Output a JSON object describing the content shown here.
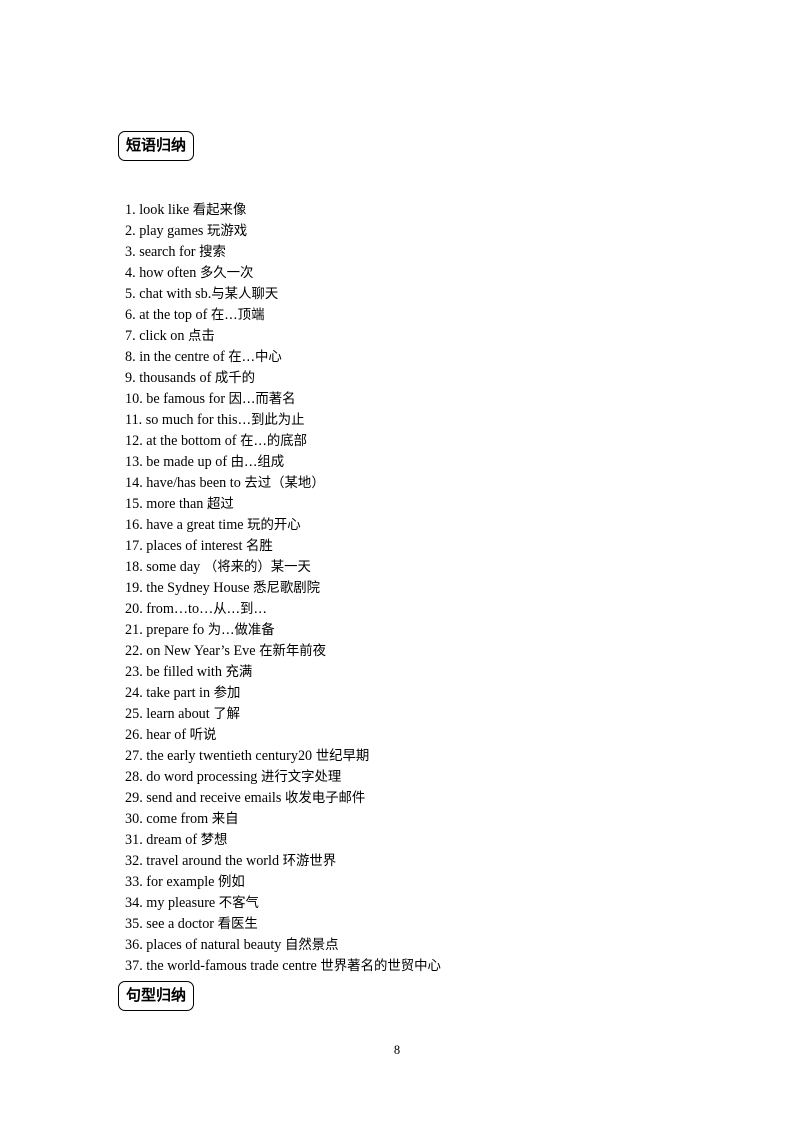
{
  "document": {
    "page_number": "8"
  },
  "sections": {
    "phrases_heading": "短语归纳",
    "sentences_heading": "句型归纳"
  },
  "phrases": [
    {
      "num": "1.",
      "english": "look like ",
      "chinese": "看起来像"
    },
    {
      "num": "2.",
      "english": "play games ",
      "chinese": "玩游戏"
    },
    {
      "num": "3.",
      "english": "search for ",
      "chinese": "搜索"
    },
    {
      "num": "4.",
      "english": "how often ",
      "chinese": "多久一次"
    },
    {
      "num": "5.",
      "english": "chat with sb.",
      "chinese": "与某人聊天"
    },
    {
      "num": "6.",
      "english": "at the top of ",
      "chinese": "在…顶端"
    },
    {
      "num": "7.",
      "english": "click on ",
      "chinese": "点击"
    },
    {
      "num": "8.",
      "english": "in the centre of  ",
      "chinese": "在…中心"
    },
    {
      "num": "9.",
      "english": "thousands of ",
      "chinese": "成千的"
    },
    {
      "num": "10.",
      "english": "be famous for ",
      "chinese": "因…而著名"
    },
    {
      "num": "11.",
      "english": "so much for this",
      "chinese": "…到此为止"
    },
    {
      "num": "12.",
      "english": "at the bottom of ",
      "chinese": "在…的底部"
    },
    {
      "num": "13.",
      "english": "be made up of ",
      "chinese": "由…组成"
    },
    {
      "num": "14.",
      "english": "have/has been to ",
      "chinese": "去过（某地）"
    },
    {
      "num": "15.",
      "english": "more than  ",
      "chinese": "超过"
    },
    {
      "num": "16.",
      "english": "have a great time ",
      "chinese": "玩的开心"
    },
    {
      "num": "17.",
      "english": "places of interest ",
      "chinese": "名胜"
    },
    {
      "num": "18.",
      "english": "some day ",
      "chinese": "（将来的）某一天"
    },
    {
      "num": "19.",
      "english": "the Sydney House ",
      "chinese": "悉尼歌剧院"
    },
    {
      "num": "20.",
      "english": "from…to…",
      "chinese": "从…到…"
    },
    {
      "num": "21.",
      "english": "prepare fo ",
      "chinese": "为…做准备"
    },
    {
      "num": "22.",
      "english": "on New Year’s Eve ",
      "chinese": "在新年前夜"
    },
    {
      "num": "23.",
      "english": "be filled with ",
      "chinese": "充满"
    },
    {
      "num": "24.",
      "english": "take part in ",
      "chinese": "参加"
    },
    {
      "num": "25.",
      "english": "learn about ",
      "chinese": "了解"
    },
    {
      "num": "26.",
      "english": "hear of ",
      "chinese": "听说"
    },
    {
      "num": "27.",
      "english": "the early twentieth century20 ",
      "chinese": "世纪早期"
    },
    {
      "num": "28.",
      "english": "do word processing ",
      "chinese": "进行文字处理"
    },
    {
      "num": "29.",
      "english": "send and receive emails ",
      "chinese": "收发电子邮件"
    },
    {
      "num": "30.",
      "english": "come from ",
      "chinese": "来自"
    },
    {
      "num": "31.",
      "english": "dream of ",
      "chinese": "梦想"
    },
    {
      "num": "32.",
      "english": "travel around the world ",
      "chinese": "环游世界"
    },
    {
      "num": "33.",
      "english": "for example ",
      "chinese": "例如"
    },
    {
      "num": "34.",
      "english": "my pleasure ",
      "chinese": "不客气"
    },
    {
      "num": "35.",
      "english": "see a doctor ",
      "chinese": "看医生"
    },
    {
      "num": "36.",
      "english": "places of natural beauty ",
      "chinese": "自然景点"
    },
    {
      "num": "37.",
      "english": "the world-famous trade centre ",
      "chinese": "世界著名的世贸中心"
    }
  ]
}
